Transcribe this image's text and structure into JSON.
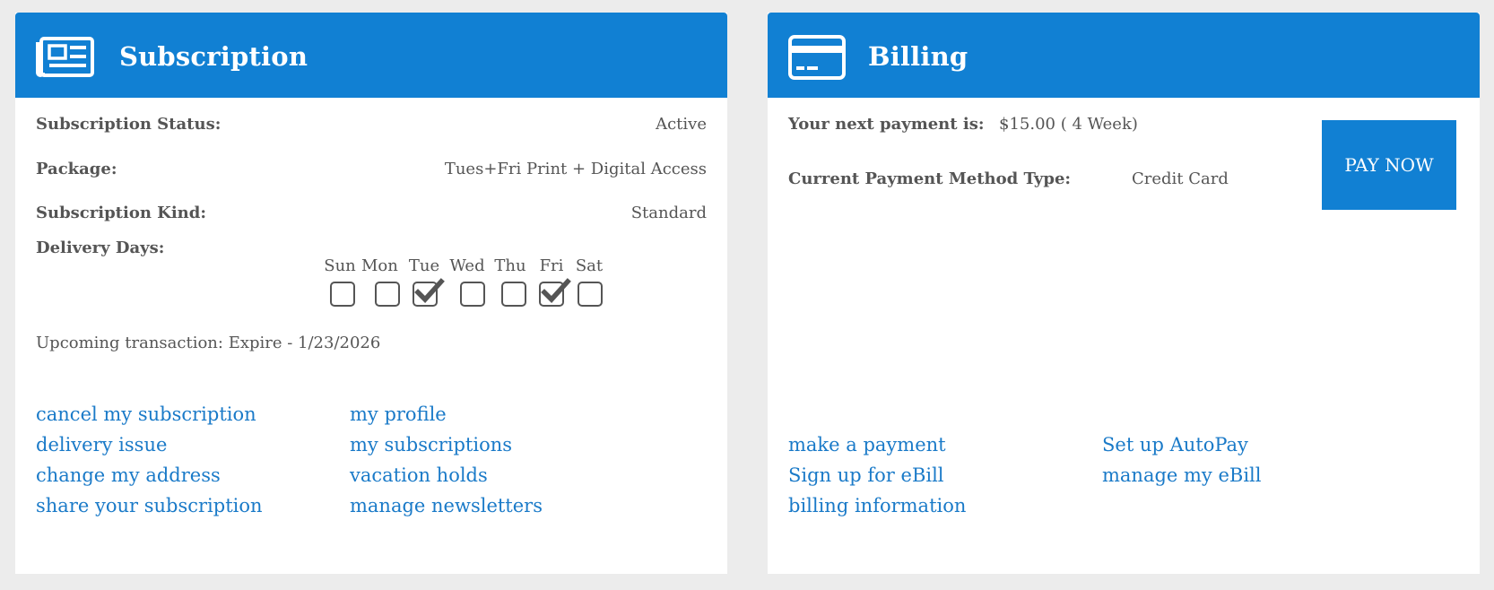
{
  "subscription": {
    "title": "Subscription",
    "icon": "newspaper-icon",
    "status_label": "Subscription Status:",
    "status_value": "Active",
    "package_label": "Package:",
    "package_value": "Tues+Fri Print + Digital Access",
    "kind_label": "Subscription Kind:",
    "kind_value": "Standard",
    "delivery_label": "Delivery Days:",
    "days": [
      {
        "name": "Sun",
        "checked": false
      },
      {
        "name": "Mon",
        "checked": false
      },
      {
        "name": "Tue",
        "checked": true
      },
      {
        "name": "Wed",
        "checked": false
      },
      {
        "name": "Thu",
        "checked": false
      },
      {
        "name": "Fri",
        "checked": true
      },
      {
        "name": "Sat",
        "checked": false
      }
    ],
    "upcoming": "Upcoming transaction: Expire - 1/23/2026",
    "links_left": [
      "cancel my subscription",
      "delivery issue",
      "change my address",
      "share your subscription"
    ],
    "links_right": [
      "my profile",
      "my subscriptions",
      "vacation holds",
      "manage newsletters"
    ]
  },
  "billing": {
    "title": "Billing",
    "icon": "credit-card-icon",
    "next_payment_label": "Your next payment is:",
    "next_payment_value": "$15.00 ( 4 Week)",
    "method_label": "Current Payment Method Type:",
    "method_value": "Credit Card",
    "pay_now_label": "PAY NOW",
    "links_left": [
      "make a payment",
      "Sign up for eBill",
      "billing information"
    ],
    "links_right": [
      "Set up AutoPay",
      "manage my eBill"
    ]
  },
  "colors": {
    "header_blue": "#1180d3",
    "link_blue": "#1a7ac8",
    "text_gray": "#555555",
    "background": "#ececec"
  }
}
